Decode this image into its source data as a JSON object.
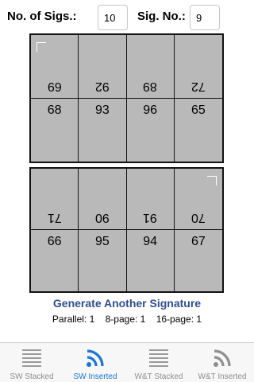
{
  "header": {
    "sigs_label": "No. of Sigs.:",
    "sigs_value": "10",
    "sig_no_label": "Sig. No.:",
    "sig_no_value": "9"
  },
  "sheet_top": {
    "row1": [
      {
        "num": "69",
        "flipped": true
      },
      {
        "num": "92",
        "flipped": true
      },
      {
        "num": "89",
        "flipped": true
      },
      {
        "num": "72",
        "flipped": true
      }
    ],
    "row2": [
      {
        "num": "68",
        "flipped": false
      },
      {
        "num": "93",
        "flipped": false
      },
      {
        "num": "96",
        "flipped": false
      },
      {
        "num": "65",
        "flipped": false
      }
    ],
    "corner_mark": "top-left"
  },
  "sheet_bottom": {
    "row1": [
      {
        "num": "71",
        "flipped": true
      },
      {
        "num": "90",
        "flipped": true
      },
      {
        "num": "91",
        "flipped": true
      },
      {
        "num": "70",
        "flipped": true
      }
    ],
    "row2": [
      {
        "num": "66",
        "flipped": false
      },
      {
        "num": "95",
        "flipped": false
      },
      {
        "num": "94",
        "flipped": false
      },
      {
        "num": "67",
        "flipped": false
      }
    ],
    "corner_mark": "top-right"
  },
  "generate_label": "Generate Another Signature",
  "counts": {
    "parallel": "Parallel: 1",
    "eight_page": "8-page: 1",
    "sixteen_page": "16-page: 1"
  },
  "tabs": [
    {
      "label": "SW Stacked",
      "icon": "stack-icon",
      "active": false
    },
    {
      "label": "SW Inserted",
      "icon": "feed-icon",
      "active": true
    },
    {
      "label": "W&T Stacked",
      "icon": "stack-icon",
      "active": false
    },
    {
      "label": "W&T Inserted",
      "icon": "feed-icon",
      "active": false
    }
  ],
  "colors": {
    "accent": "#1a75d6",
    "link": "#2f4d8f",
    "page_fill": "#b9b9b9",
    "tab_inactive": "#8e8e8e"
  }
}
